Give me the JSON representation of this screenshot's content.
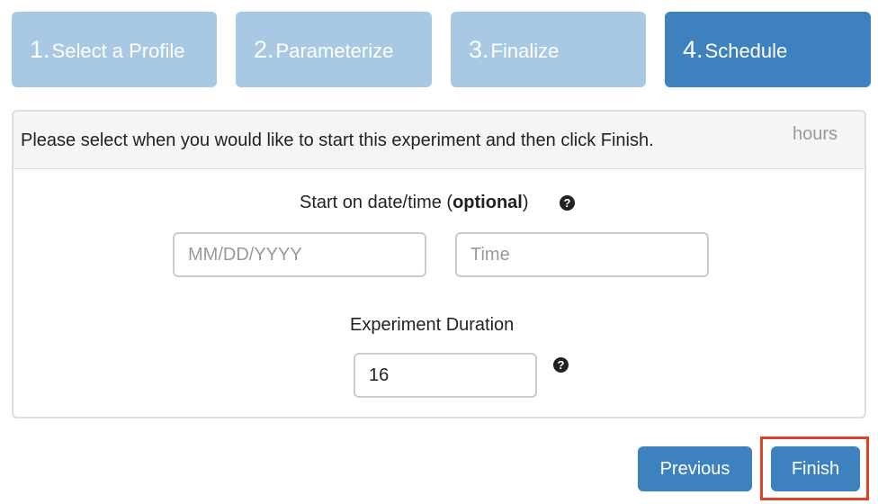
{
  "wizard": {
    "steps": [
      {
        "number": "1.",
        "label": "Select a Profile",
        "state": "complete"
      },
      {
        "number": "2.",
        "label": "Parameterize",
        "state": "complete"
      },
      {
        "number": "3.",
        "label": "Finalize",
        "state": "complete"
      },
      {
        "number": "4.",
        "label": "Schedule",
        "state": "active"
      }
    ]
  },
  "panel": {
    "instruction": "Please select when you would like to start this experiment and then click Finish.",
    "hours_hint": "hours",
    "start": {
      "label_prefix": "Start on date/time (",
      "label_bold": "optional",
      "label_suffix": ")",
      "date_placeholder": "MM/DD/YYYY",
      "time_placeholder": "Time",
      "help_icon": "question-circle-icon"
    },
    "duration": {
      "label": "Experiment Duration",
      "value": "16",
      "help_icon": "question-circle-icon"
    }
  },
  "footer": {
    "previous_label": "Previous",
    "finish_label": "Finish"
  },
  "colors": {
    "step_inactive": "#a8c8e3",
    "step_active": "#3d82be",
    "button": "#3d82be",
    "highlight": "#e0412a"
  }
}
